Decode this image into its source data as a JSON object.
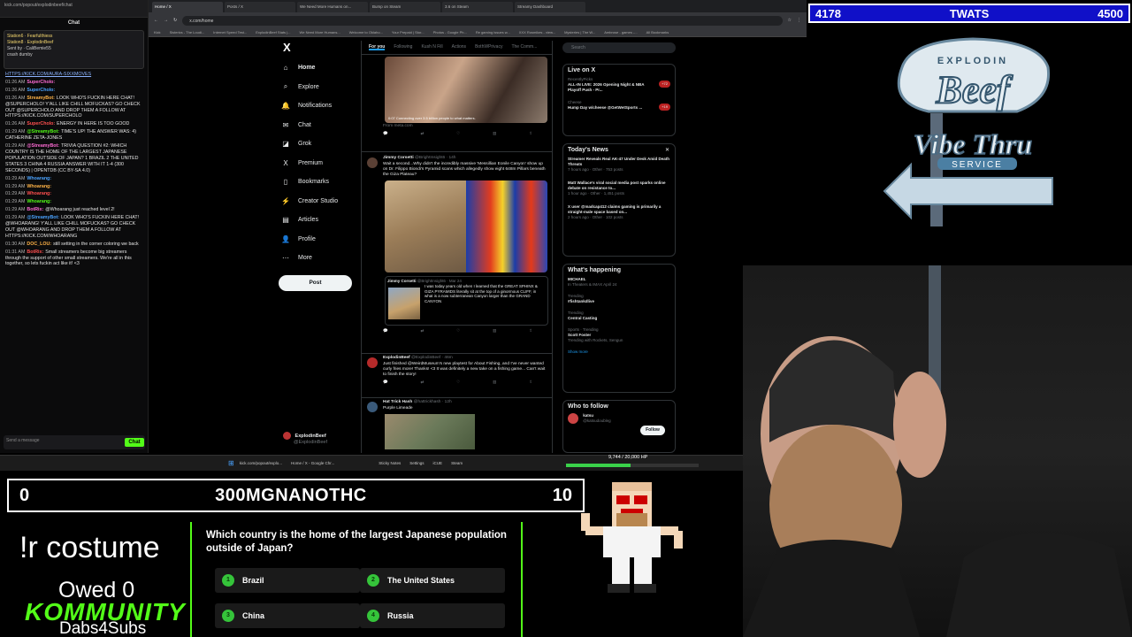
{
  "chat": {
    "tab_text": "kick.com/popout/explodinbeef/chat",
    "title": "Chat",
    "pinned": [
      "Station6 · Fearfulthiess",
      "Station8 · ExplodinBeef",
      "Sent by · CaliBemie55",
      "crash dumby"
    ],
    "messages": [
      {
        "ts": "",
        "user": "",
        "text": "HTTPS://KICK.COM/AURA-SIXXMOVES",
        "link": true
      },
      {
        "ts": "01:26 AM",
        "user": "SuperCholo:",
        "text": ""
      },
      {
        "ts": "01:26 AM",
        "user": "SuperCholo:",
        "text": ""
      },
      {
        "ts": "01:26 AM",
        "user": "StreamyBot:",
        "text": "LOOK WHO'S FUCKIN HERE CHAT! @SUPERCHOLO! Y'ALL LIKE CHILL MOFUCKAS? GO CHECK OUT @SUPERCHOLO AND DROP THEM A FOLLOW AT HTTPS://KICK.COM/SUPERCHOLO"
      },
      {
        "ts": "01:26 AM",
        "user": "SuperCholo:",
        "text": "ENERGY IN HERE IS TOO GOOD"
      },
      {
        "ts": "01:29 AM",
        "user": "@StreamyBot:",
        "text": "TIME'S UP! THE ANSWER WAS: 4) CATHERINE ZETA-JONES"
      },
      {
        "ts": "01:29 AM",
        "user": "@StreamyBot:",
        "text": "TRIVIA QUESTION #2: WHICH COUNTRY IS THE HOME OF THE LARGEST JAPANESE POPULATION OUTSIDE OF JAPAN? 1 BRAZIL 2 THE UNITED STATES 3 CHINA 4 RUSSIA ANSWER WITH IT 1-4 (300 SECONDS) | OPENTDB (CC BY-SA 4.0)"
      },
      {
        "ts": "01:29 AM",
        "user": "Whoarang:",
        "text": ""
      },
      {
        "ts": "01:29 AM",
        "user": "Whoarang:",
        "text": ""
      },
      {
        "ts": "01:29 AM",
        "user": "Whoarang:",
        "text": ""
      },
      {
        "ts": "01:29 AM",
        "user": "Whoarang:",
        "text": ""
      },
      {
        "ts": "01:29 AM",
        "user": "BotRix:",
        "text": "@Whoarang just reached level 2!"
      },
      {
        "ts": "01:29 AM",
        "user": "@StreamyBot:",
        "text": "LOOK WHO'S FUCKIN HERE CHAT! @WHOARANG! Y'ALL LIKE CHILL MOFUCKAS? GO CHECK OUT @WHOARANG AND DROP THEM A FOLLOW AT HTTPS://KICK.COM/WHOARANG"
      },
      {
        "ts": "01:30 AM",
        "user": "DOC_LOU:",
        "text": "still setting in the corner coloring we back"
      },
      {
        "ts": "01:31 AM",
        "user": "BotRix:",
        "text": "Small streamers become big streamers through the support of other small streamers. We're all in this together, so lets fuckin act like it! <3"
      }
    ],
    "input_placeholder": "Send a message",
    "send_label": "Chat"
  },
  "browser": {
    "tabs": [
      "Home / X",
      "Posts / X",
      "We Need More Humans on...",
      "Bump on Steam",
      "3.6 on Steam",
      "Streamy Dashboard"
    ],
    "active_tab": 0,
    "url": "x.com/home",
    "bookmarks": [
      "Kick",
      "Sisterics - The Loudi...",
      "Internet Speed Test...",
      "ExplodinBeef Stats |...",
      "We Need More Humans...",
      "Welcome to Oklaho...",
      "Your Prepaid | Stor...",
      "Photos - Google Ph...",
      "Re gaming issues w...",
      "XXX Rosmikes - view...",
      "Mysteries | The W...",
      "Ambrose - games -...",
      "All Bookmarks"
    ]
  },
  "x": {
    "logo": "X",
    "nav": [
      {
        "icon": "⌂",
        "label": "Home",
        "name": "home"
      },
      {
        "icon": "⌕",
        "label": "Explore",
        "name": "explore"
      },
      {
        "icon": "🔔",
        "label": "Notifications",
        "name": "notifications"
      },
      {
        "icon": "✉",
        "label": "Chat",
        "name": "chat"
      },
      {
        "icon": "◪",
        "label": "Grok",
        "name": "grok"
      },
      {
        "icon": "X",
        "label": "Premium",
        "name": "premium"
      },
      {
        "icon": "▯",
        "label": "Bookmarks",
        "name": "bookmarks"
      },
      {
        "icon": "⚡",
        "label": "Creator Studio",
        "name": "creator-studio"
      },
      {
        "icon": "▤",
        "label": "Articles",
        "name": "articles"
      },
      {
        "icon": "👤",
        "label": "Profile",
        "name": "profile"
      },
      {
        "icon": "⋯",
        "label": "More",
        "name": "more"
      }
    ],
    "post_label": "Post",
    "account": {
      "name": "ExplodinBeef",
      "handle": "@ExplodinBeef"
    },
    "feed_tabs": [
      "For you",
      "Following",
      "Kush N Fill",
      "Actions",
      "BothWPrivacy",
      "The Comm..."
    ],
    "tweets": [
      {
        "caption": "0:07   Connecting over 3.5 billion people to what matters.",
        "source": "From meta.com"
      },
      {
        "name": "Jimmy Corsetti",
        "handle": "@BrightInsight6 · 14h",
        "text": "Wait a second...Why didn't the incredibly massive 'Messillian Eonile Canyon' show up on Dr. Filippo Biondi's Pyramid scans which allegedly show eight 648m Pillars beneath the Giza Plateau?"
      },
      {
        "name": "Jimmy Corsetti",
        "handle": "@BrightInsight6 · Mar 24",
        "text": "I was today years old when I learned that the GREAT SPHINX & GIZA PYRAMIDS literally sit at the top of a ginormous CLIFF, in what is a now subterranean Canyon larger than the GRAND CANYON"
      },
      {
        "name": "ExplodinBeef",
        "handle": "@ExplodinBeef · 46m",
        "text": "Just finished @WeirdMuseum's new playtest for About Fishing, and I've never wanted curly fries more! Thanks! <3 It was definitely a new take on a fishing game... Can't wait to finish the story!"
      },
      {
        "name": "Hat Trick Hash",
        "handle": "@hattrickhash · 12h",
        "text": "Purple Limeade"
      }
    ],
    "search_placeholder": "Search",
    "live": {
      "title": "Live on X",
      "items": [
        {
          "host": "RecentlyPicks",
          "text": "ALL-IN LIVE: 2026 Opening Night & NBA Playoff Push - Pr...",
          "badge": "+72"
        },
        {
          "host": "Cheese",
          "text": "Hump Day w/cheese @GetWetSports ...",
          "badge": "+19"
        }
      ]
    },
    "news": {
      "title": "Today's News",
      "items": [
        {
          "head": "Streamer Reveals Real AK-47 Under Desk Amid Death Threats",
          "meta": "7 hours ago · Other · 753 posts"
        },
        {
          "head": "Matt Wallace's viral social media post sparks online debate on resistance to...",
          "meta": "1 hour ago · Other · 1,451 posts"
        },
        {
          "head": "X user @madcap412 claims gaming is primarily a straight-male space based on...",
          "meta": "2 hours ago · Other · 102 posts"
        }
      ]
    },
    "happening": {
      "title": "What's happening",
      "items": [
        {
          "cat": "",
          "head": "MICHAEL",
          "meta": "In Theaters & IMAX April 24"
        },
        {
          "cat": "Trending",
          "head": "#fishtankdlive",
          "meta": ""
        },
        {
          "cat": "Trending",
          "head": "Central Casting",
          "meta": ""
        },
        {
          "cat": "Sports · Trending",
          "head": "Scott Foster",
          "meta": "Trending with Rockets, Sengun"
        }
      ],
      "more": "Show more"
    },
    "who": {
      "title": "Who to follow",
      "name": "katsu",
      "handle": "@katsudoubleg",
      "follow": "Follow"
    }
  },
  "taskbar": {
    "url_item": "kick.com/popout/explo...",
    "browser_item": "Home / X - Google Chr...",
    "sticky": "Sticky Notes",
    "settings": "Settings",
    "icue": "iCUE",
    "steam": "Steam",
    "hp_text": "9,744 / 20,000 HP",
    "hp_fraction": 0.487
  },
  "overlay": {
    "top_left": "4178",
    "top_title": "TWATS",
    "top_right": "4500",
    "logo_top": "EXPLODIN",
    "logo_beef": "Beef",
    "logo_vibe": "Vibe Thru",
    "logo_service": "SERVICE",
    "bottom_left": "0",
    "bottom_title": "300MGNANOTHC",
    "bottom_right": "10",
    "command": "!r costume",
    "owed": "Owed 0",
    "community": "KOMMUNITY",
    "dabs": "Dabs4Subs",
    "question": "Which country is the home of the largest Japanese population outside of Japan?",
    "answers": [
      {
        "n": "1",
        "t": "Brazil"
      },
      {
        "n": "2",
        "t": "The United States"
      },
      {
        "n": "3",
        "t": "China"
      },
      {
        "n": "4",
        "t": "Russia"
      }
    ]
  }
}
